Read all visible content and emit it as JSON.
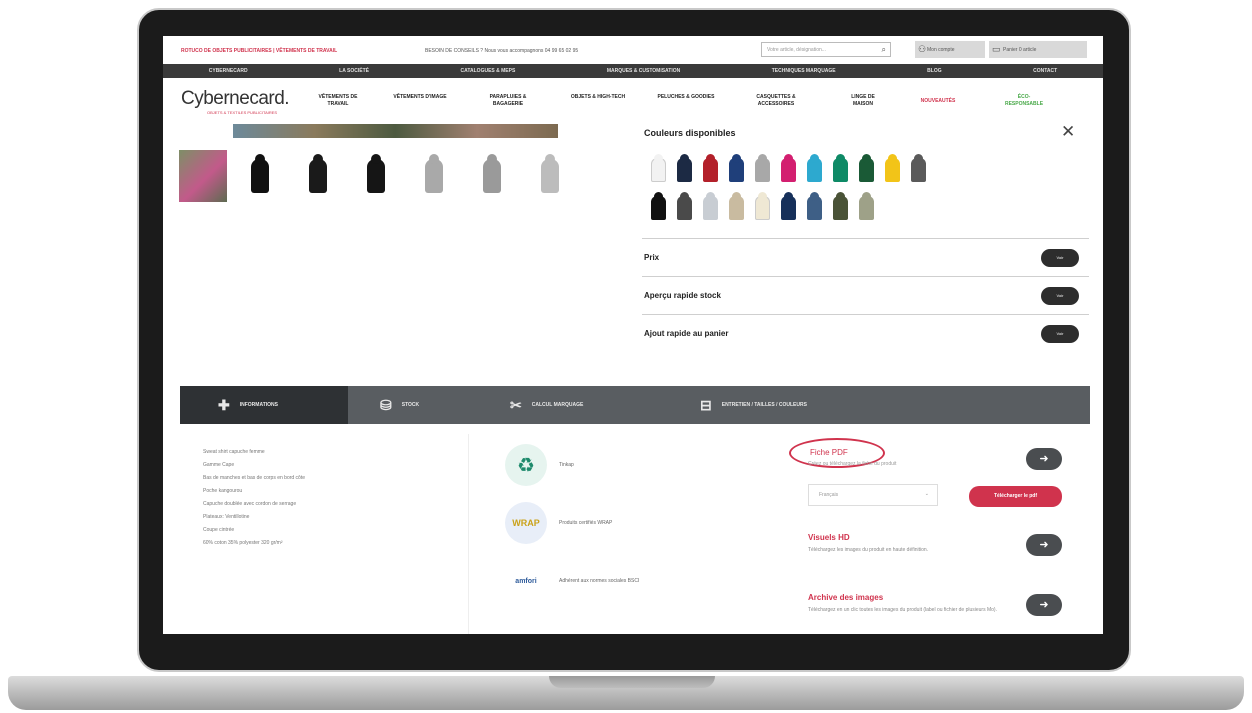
{
  "topbar": {
    "promo": "ROTUCO DE OBJETS PUBLICITAIRES | VÊTEMENTS DE TRAVAIL",
    "contact": "BESOIN DE CONSEILS ? Nous vous accompagnons 04 99 65 02 95",
    "search_placeholder": "Votre article, désignation...",
    "account": "Mon compte",
    "cart": "Panier 0 article"
  },
  "darknav": [
    "CYBERNECARD",
    "LA SOCIÉTÉ",
    "CATALOGUES & MEPS",
    "MARQUES & CUSTOMISATION",
    "TECHNIQUES MARQUAGE",
    "BLOG",
    "CONTACT"
  ],
  "logo": {
    "text": "Cybernecard.",
    "sub": "OBJETS & TEXTILES PUBLICITAIRES"
  },
  "menu": [
    "VÊTEMENTS DE TRAVAIL",
    "VÊTEMENTS D'IMAGE",
    "PARAPLUIES & BAGAGERIE",
    "OBJETS & HIGH-TECH",
    "PELUCHES & GOODIES",
    "CASQUETTES & ACCESSOIRES",
    "LINGE DE MAISON",
    "NOUVEAUTÉS",
    "ÉCO-RESPONSABLE"
  ],
  "colors": {
    "title": "Couleurs disponibles",
    "row1": [
      "#f2f2f2",
      "#1c2a44",
      "#b3202a",
      "#1f3f7a",
      "#a8a8a8",
      "#d31f70",
      "#2da9cf",
      "#0e8a66",
      "#1a5a36",
      "#f2c418",
      "#5a5a5a"
    ],
    "row2": [
      "#111111",
      "#4a4a4a",
      "#c8cdd3",
      "#c9bba0",
      "#efe8d4",
      "#16305a",
      "#3e5f86",
      "#4a5337",
      "#9ea188"
    ]
  },
  "accordion": [
    {
      "label": "Prix",
      "button": "Voir"
    },
    {
      "label": "Aperçu rapide stock",
      "button": "Voir"
    },
    {
      "label": "Ajout rapide au panier",
      "button": "Voir"
    }
  ],
  "tabs": [
    "INFORMATIONS",
    "STOCK",
    "CALCUL MARQUAGE",
    "ENTRETIEN / TAILLES / COULEURS"
  ],
  "info_lines": [
    "Sweat shirt capuche femme",
    "Gamme Cape",
    "Bas de manches et bas de corps en bord côte",
    "Poche kangourou",
    "Capuche doublée avec cordon de serrage",
    "Plateaux: Ventillotine",
    "Coupe cintrée",
    "60% coton 35% polyester 320 gr/m²"
  ],
  "labels": [
    {
      "text": "Tinkap",
      "icon": "recycle-icon"
    },
    {
      "text": "Produits certifiés WRAP",
      "icon": "wrap-icon"
    },
    {
      "text": "Adhérent aux normes sociales BSCI",
      "icon": "amfori-icon"
    }
  ],
  "pdf": {
    "title": "Fiche PDF",
    "desc": "Créez ou téléchargez la fiche du produit",
    "select_value": "Français",
    "download": "Télécharger le pdf"
  },
  "visuals": {
    "title": "Visuels HD",
    "desc": "Téléchargez les images du produit en haute définition."
  },
  "archive": {
    "title": "Archive des images",
    "desc": "Téléchargez en un clic toutes les images du produit (label ou fichier de plusieurs Mo)."
  }
}
